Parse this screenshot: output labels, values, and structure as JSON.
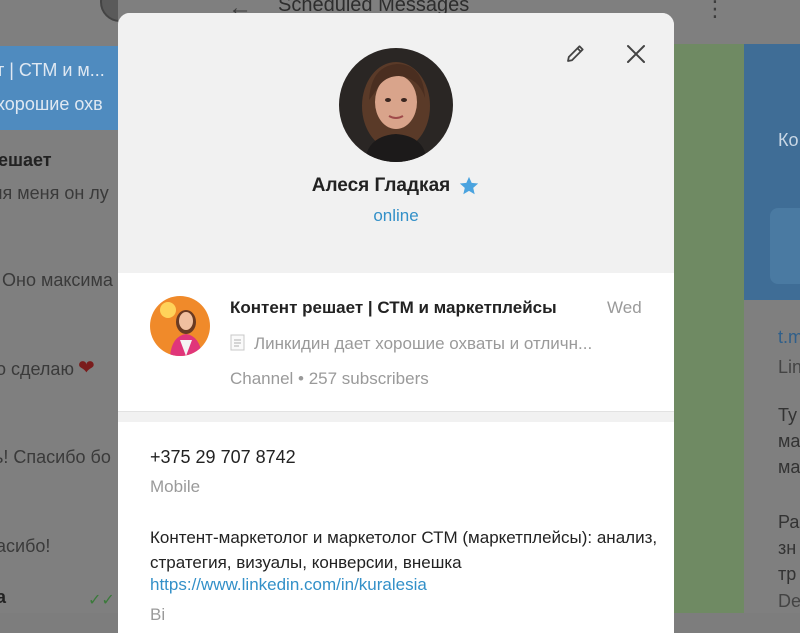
{
  "background": {
    "window_title": "Scheduled Messages",
    "left_header_line1": "т | СТМ и м...",
    "left_header_line2": "хорошие охв",
    "left_lines": [
      "ешает",
      "ля меня он лу",
      "Оно максима",
      "о сделаю",
      "ь! Спасибо бо",
      "асибо!",
      "а"
    ],
    "right_lines": [
      "Ко",
      "t.m",
      "Lin",
      "Ту",
      "ма",
      "ма",
      "Ра",
      "зн",
      "тр",
      "De"
    ]
  },
  "modal": {
    "name": "Алеся Гладкая",
    "status": "online",
    "channel": {
      "name": "Контент решает | СТМ и маркетплейсы",
      "date": "Wed",
      "preview": "Линкидин дает хорошие охваты и отличн...",
      "meta": "Channel • 257 subscribers"
    },
    "phone": "+375 29 707 8742",
    "phone_label": "Mobile",
    "bio": "Контент-маркетолог и маркетолог СТМ (маркетплейсы): анализ, стратегия, визуалы, конверсии, внешка",
    "bio_link": "https://www.linkedin.com/in/kuralesia",
    "bio_cut": "Bi"
  },
  "icons": {
    "edit": "pencil-icon",
    "close": "close-icon",
    "premium": "star-icon",
    "document": "document-icon"
  },
  "colors": {
    "accent": "#3390c8",
    "star": "#4aa3df",
    "modal_header_bg": "#f1f1f1"
  }
}
